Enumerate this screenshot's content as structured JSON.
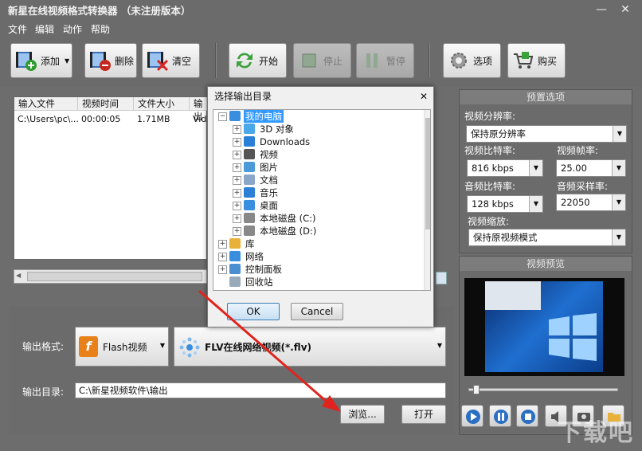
{
  "window": {
    "title": "新星在线视频格式转换器 （未注册版本）",
    "minimize": "—",
    "close": "✕"
  },
  "menu": [
    "文件",
    "编辑",
    "动作",
    "帮助"
  ],
  "toolbar": {
    "add": "添加",
    "delete": "删除",
    "clear": "清空",
    "start": "开始",
    "stop": "停止",
    "pause": "暂停",
    "options": "选项",
    "buy": "购买"
  },
  "file_list": {
    "columns": [
      "输入文件",
      "视频时间",
      "文件大小",
      "输出"
    ],
    "rows": [
      [
        "C:\\Users\\pc\\...",
        "00:00:05",
        "1.71MB",
        "Vide"
      ]
    ]
  },
  "preset": {
    "title": "预置选项",
    "resolution_label": "视频分辨率:",
    "resolution_value": "保持原分辨率",
    "vbitrate_label": "视频比特率:",
    "vbitrate_value": "816 kbps",
    "framerate_label": "视频帧率:",
    "framerate_value": "25.00",
    "abitrate_label": "音频比特率:",
    "abitrate_value": "128 kbps",
    "samplerate_label": "音频采样率:",
    "samplerate_value": "22050",
    "scale_label": "视频缩放:",
    "scale_value": "保持原视频模式"
  },
  "preview": {
    "title": "视频预览",
    "slider_fraction": 0.03
  },
  "output": {
    "format_label": "输出格式:",
    "format_category": "Flash视频",
    "format_type": "FLV在线网络视频(*.flv)",
    "dir_label": "输出目录:",
    "dir_value": "C:\\新星视频软件\\输出",
    "browse": "浏览...",
    "open": "打开"
  },
  "dialog": {
    "title": "选择输出目录",
    "close": "✕",
    "tree": [
      {
        "label": "我的电脑",
        "level": 0,
        "expander": "−",
        "icon": "computer",
        "selected": true
      },
      {
        "label": "3D 对象",
        "level": 1,
        "expander": "+",
        "icon": "3d-objects"
      },
      {
        "label": "Downloads",
        "level": 1,
        "expander": "+",
        "icon": "download"
      },
      {
        "label": "视频",
        "level": 1,
        "expander": "+",
        "icon": "video"
      },
      {
        "label": "图片",
        "level": 1,
        "expander": "+",
        "icon": "picture"
      },
      {
        "label": "文档",
        "level": 1,
        "expander": "+",
        "icon": "document"
      },
      {
        "label": "音乐",
        "level": 1,
        "expander": "+",
        "icon": "music"
      },
      {
        "label": "桌面",
        "level": 1,
        "expander": "+",
        "icon": "desktop"
      },
      {
        "label": "本地磁盘 (C:)",
        "level": 1,
        "expander": "+",
        "icon": "drive"
      },
      {
        "label": "本地磁盘 (D:)",
        "level": 1,
        "expander": "+",
        "icon": "drive"
      },
      {
        "label": "库",
        "level": 0,
        "expander": "+",
        "icon": "library"
      },
      {
        "label": "网络",
        "level": 0,
        "expander": "+",
        "icon": "network"
      },
      {
        "label": "控制面板",
        "level": 0,
        "expander": "+",
        "icon": "control-panel"
      },
      {
        "label": "回收站",
        "level": 0,
        "expander": "",
        "icon": "recycle-bin"
      }
    ],
    "ok": "OK",
    "cancel": "Cancel"
  },
  "colors": {
    "accent_arrow": "#e0241d",
    "selection": "#3399ff"
  },
  "watermark": "下载吧"
}
